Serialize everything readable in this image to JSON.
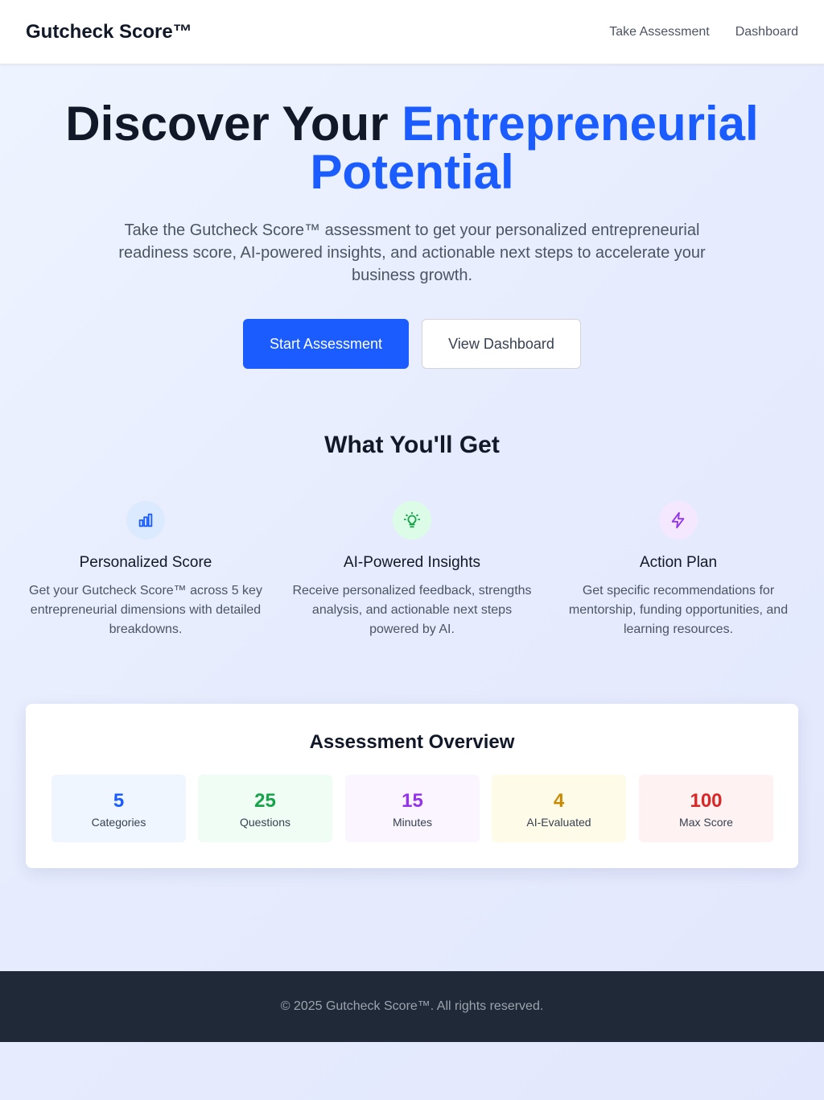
{
  "header": {
    "brand": "Gutcheck Score™",
    "nav": [
      "Take Assessment",
      "Dashboard"
    ]
  },
  "hero": {
    "title_plain": "Discover Your ",
    "title_accent_1": "Entrepreneurial",
    "title_accent_2": "Potential",
    "subtitle": "Take the Gutcheck Score™ assessment to get your personalized entrepreneurial readiness score, AI-powered insights, and actionable next steps to accelerate your business growth.",
    "primary_button": "Start Assessment",
    "secondary_button": "View Dashboard"
  },
  "features": {
    "title": "What You'll Get",
    "items": [
      {
        "icon": "bar-chart-icon",
        "title": "Personalized Score",
        "description": "Get your Gutcheck Score™ across 5 key entrepreneurial dimensions with detailed breakdowns.",
        "icon_color": "#1a5cff",
        "icon_bg": "#dbeafe"
      },
      {
        "icon": "lightbulb-icon",
        "title": "AI-Powered Insights",
        "description": "Receive personalized feedback, strengths analysis, and actionable next steps powered by AI.",
        "icon_color": "#16a34a",
        "icon_bg": "#dcfce7"
      },
      {
        "icon": "lightning-icon",
        "title": "Action Plan",
        "description": "Get specific recommendations for mentorship, funding opportunities, and learning resources.",
        "icon_color": "#9333ea",
        "icon_bg": "#f3e8ff"
      }
    ]
  },
  "overview": {
    "title": "Assessment Overview",
    "stats": [
      {
        "value": "5",
        "label": "Categories",
        "color": "#1a5cff",
        "bg": "#eff6ff"
      },
      {
        "value": "25",
        "label": "Questions",
        "color": "#16a34a",
        "bg": "#f0fdf4"
      },
      {
        "value": "15",
        "label": "Minutes",
        "color": "#9333ea",
        "bg": "#faf5ff"
      },
      {
        "value": "4",
        "label": "AI-Evaluated",
        "color": "#ca8a04",
        "bg": "#fefce8"
      },
      {
        "value": "100",
        "label": "Max Score",
        "color": "#dc2626",
        "bg": "#fef2f2"
      }
    ]
  },
  "footer": {
    "text": "© 2025 Gutcheck Score™. All rights reserved."
  }
}
